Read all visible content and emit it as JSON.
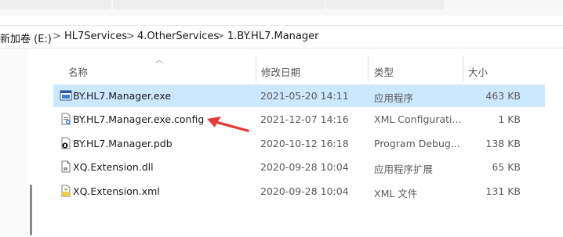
{
  "breadcrumb": {
    "items": [
      "新加卷 (E:)",
      "HL7Services",
      "4.OtherServices",
      "1.BY.HL7.Manager"
    ],
    "separator": ">"
  },
  "columns": {
    "name": "名称",
    "date": "修改日期",
    "type": "类型",
    "size": "大小"
  },
  "files": [
    {
      "name": "BY.HL7.Manager.exe",
      "date": "2021-05-20 14:11",
      "type": "应用程序",
      "size": "463 KB",
      "icon": "exe-icon",
      "selected": true
    },
    {
      "name": "BY.HL7.Manager.exe.config",
      "date": "2021-12-07 14:16",
      "type": "XML Configurati...",
      "size": "1 KB",
      "icon": "config-file-icon",
      "selected": false
    },
    {
      "name": "BY.HL7.Manager.pdb",
      "date": "2020-10-12 16:18",
      "type": "Program Debug...",
      "size": "138 KB",
      "icon": "pdb-file-icon",
      "selected": false
    },
    {
      "name": "XQ.Extension.dll",
      "date": "2020-09-28 10:04",
      "type": "应用程序扩展",
      "size": "65 KB",
      "icon": "dll-file-icon",
      "selected": false
    },
    {
      "name": "XQ.Extension.xml",
      "date": "2020-09-28 10:04",
      "type": "XML 文件",
      "size": "131 KB",
      "icon": "xml-file-icon",
      "selected": false
    }
  ],
  "colors": {
    "selection": "#cce8ff",
    "annotation_arrow": "#e53935"
  }
}
